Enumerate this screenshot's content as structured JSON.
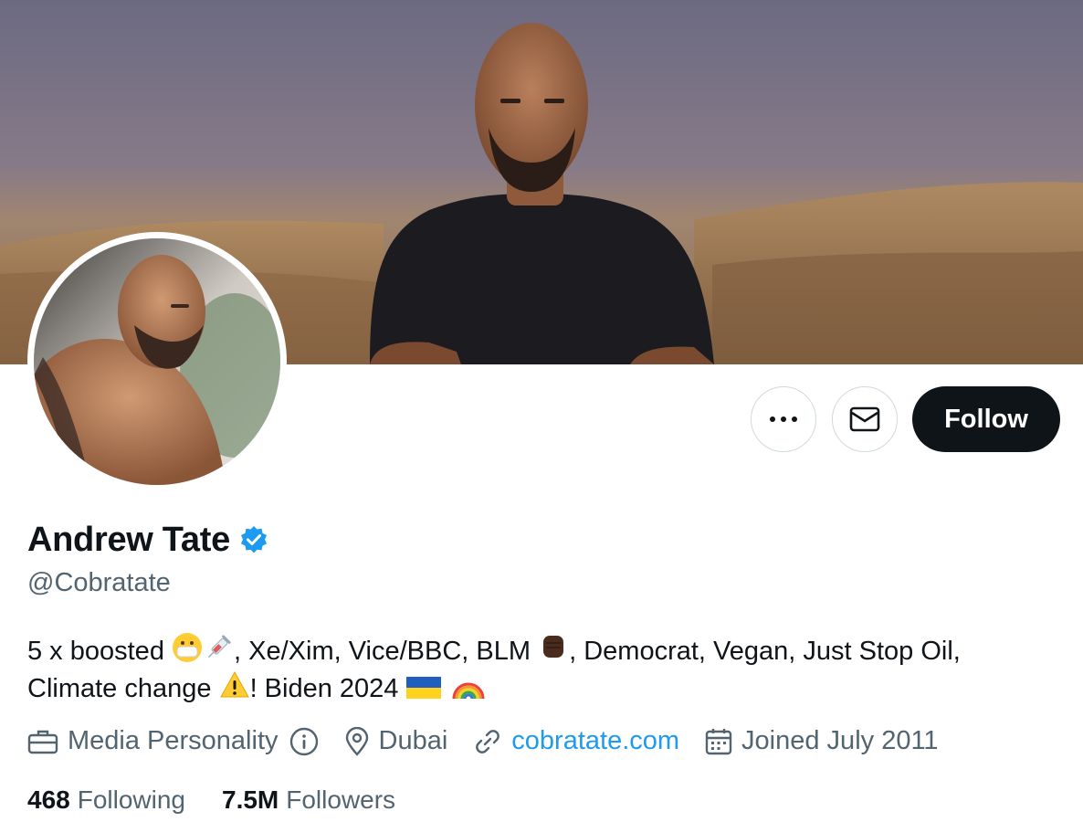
{
  "profile": {
    "display_name": "Andrew Tate",
    "handle": "@Cobratate",
    "verified_icon": "verified-badge-icon",
    "bio": {
      "part1": "5 x boosted",
      "part2": ", Xe/Xim, Vice/BBC, BLM",
      "part3": ", Democrat, Vegan, Just Stop Oil,",
      "part4": "Climate change",
      "part5": "! Biden 2024"
    },
    "meta": {
      "category": "Media Personality",
      "location": "Dubai",
      "website": "cobratate.com",
      "joined": "Joined July 2011"
    },
    "stats": {
      "following_count": "468",
      "following_label": "Following",
      "followers_count": "7.5M",
      "followers_label": "Followers"
    }
  },
  "actions": {
    "follow_label": "Follow"
  },
  "colors": {
    "accent": "#1d9bf0",
    "text_primary": "#0f1419",
    "text_secondary": "#536471",
    "border": "#cfd9de"
  }
}
